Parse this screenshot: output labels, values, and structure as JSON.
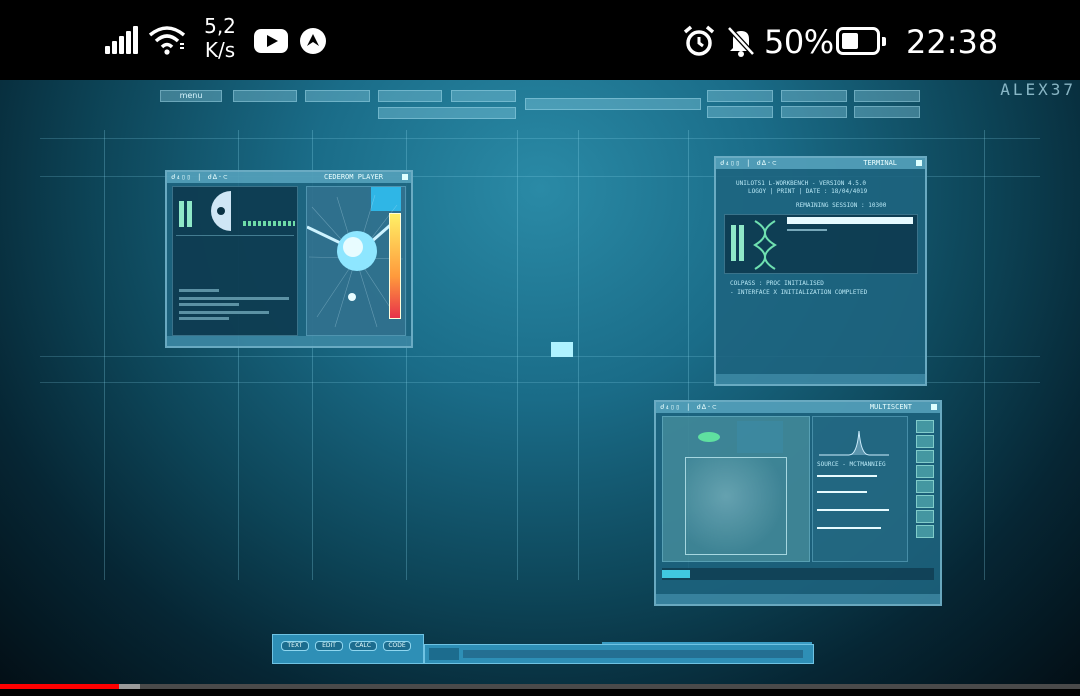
{
  "status_bar": {
    "net_speed_value": "5,2",
    "net_speed_unit": "K/s",
    "battery_percent": "50%",
    "battery_level": 0.5,
    "time": "22:38",
    "icons": [
      "signal-icon",
      "wifi-icon",
      "youtube-icon",
      "navigation-icon",
      "alarm-icon",
      "mute-icon",
      "battery-icon"
    ]
  },
  "video": {
    "brand": "ALEX37",
    "top_menu": {
      "menu_label": "menu"
    },
    "windows": {
      "cd_player": {
        "tabs": "ძ₄▯▯ | ძ∆·⊂",
        "title": "CEDEROM PLAYER"
      },
      "terminal": {
        "tabs": "ძ₄▯▯ | ძ∆·⊂",
        "title": "TERMINAL",
        "line1": "UNILOTS1 L-WORKBENCH - VERSION 4.5.0",
        "line2": "LOGOY | PRINT | DATE : 18/04/4019",
        "line3": "REMAINING SESSION : 10300",
        "line4": "COLPASS : PROC INITIALISED",
        "line5": "- INTERFACE X INITIALIZATION COMPLETED"
      },
      "multiscent": {
        "tabs": "ძ₄▯▯ | ძ∆·⊂",
        "title": "MULTISCENT",
        "label": "SOURCE - MCTMANNIEG"
      }
    },
    "taskbar": {
      "btn1": "TEXT",
      "btn2": "EDIT",
      "btn3": "CALC",
      "btn4": "CODE"
    }
  },
  "playback": {
    "played_fraction": 0.11,
    "buffered_fraction": 0.13
  }
}
